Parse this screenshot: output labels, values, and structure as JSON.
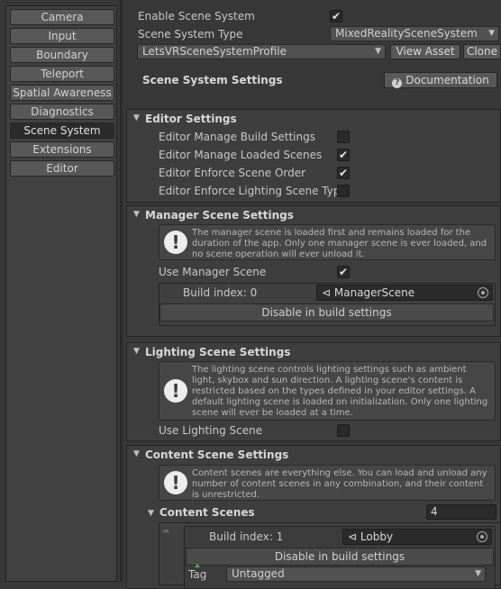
{
  "nav": {
    "items": [
      "Camera",
      "Input",
      "Boundary",
      "Teleport",
      "Spatial Awareness",
      "Diagnostics",
      "Scene System",
      "Extensions",
      "Editor"
    ],
    "active_index": 6
  },
  "top": {
    "enable_label": "Enable Scene System",
    "enable_checked": true,
    "type_label": "Scene System Type",
    "type_value": "MixedRealitySceneSystem",
    "profile_value": "LetsVRSceneSystemProfile",
    "view_asset_label": "View Asset",
    "clone_label": "Clone"
  },
  "settings": {
    "title": "Scene System Settings",
    "documentation_label": "Documentation"
  },
  "editor_settings": {
    "title": "Editor Settings",
    "rows": [
      {
        "label": "Editor Manage Build Settings",
        "checked": false
      },
      {
        "label": "Editor Manage Loaded Scenes",
        "checked": true
      },
      {
        "label": "Editor Enforce Scene Order",
        "checked": true
      },
      {
        "label": "Editor Enforce Lighting Scene Type",
        "checked": false
      }
    ]
  },
  "manager": {
    "title": "Manager Scene Settings",
    "info": "The manager scene is loaded first and remains loaded for the duration of the app. Only one manager scene is ever loaded, and no scene operation will ever unload it.",
    "use_label": "Use Manager Scene",
    "use_checked": true,
    "build_index_label": "Build index: 0",
    "scene_value": "ManagerScene",
    "disable_label": "Disable in build settings"
  },
  "lighting": {
    "title": "Lighting Scene Settings",
    "info": "The lighting scene controls lighting settings such as ambient light, skybox and sun direction. A lighting scene's content is restricted based on the types defined in your editor settings. A default lighting scene is loaded on initialization. Only one lighting scene will ever be loaded at a time.",
    "use_label": "Use Lighting Scene",
    "use_checked": false
  },
  "content": {
    "title": "Content Scene Settings",
    "info": "Content scenes are everything else. You can load and unload any number of content scenes in any combination, and their content is unrestricted.",
    "scenes_label": "Content Scenes",
    "scenes_count": "4",
    "item": {
      "build_index_label": "Build index: 1",
      "scene_value": "Lobby",
      "disable_label": "Disable in build settings",
      "tag_label": "Tag",
      "tag_value": "Untagged"
    }
  },
  "glyphs": {
    "check": "✔",
    "arrow_down": "▼",
    "info": "!",
    "scene": "⊲",
    "handle": "═"
  }
}
